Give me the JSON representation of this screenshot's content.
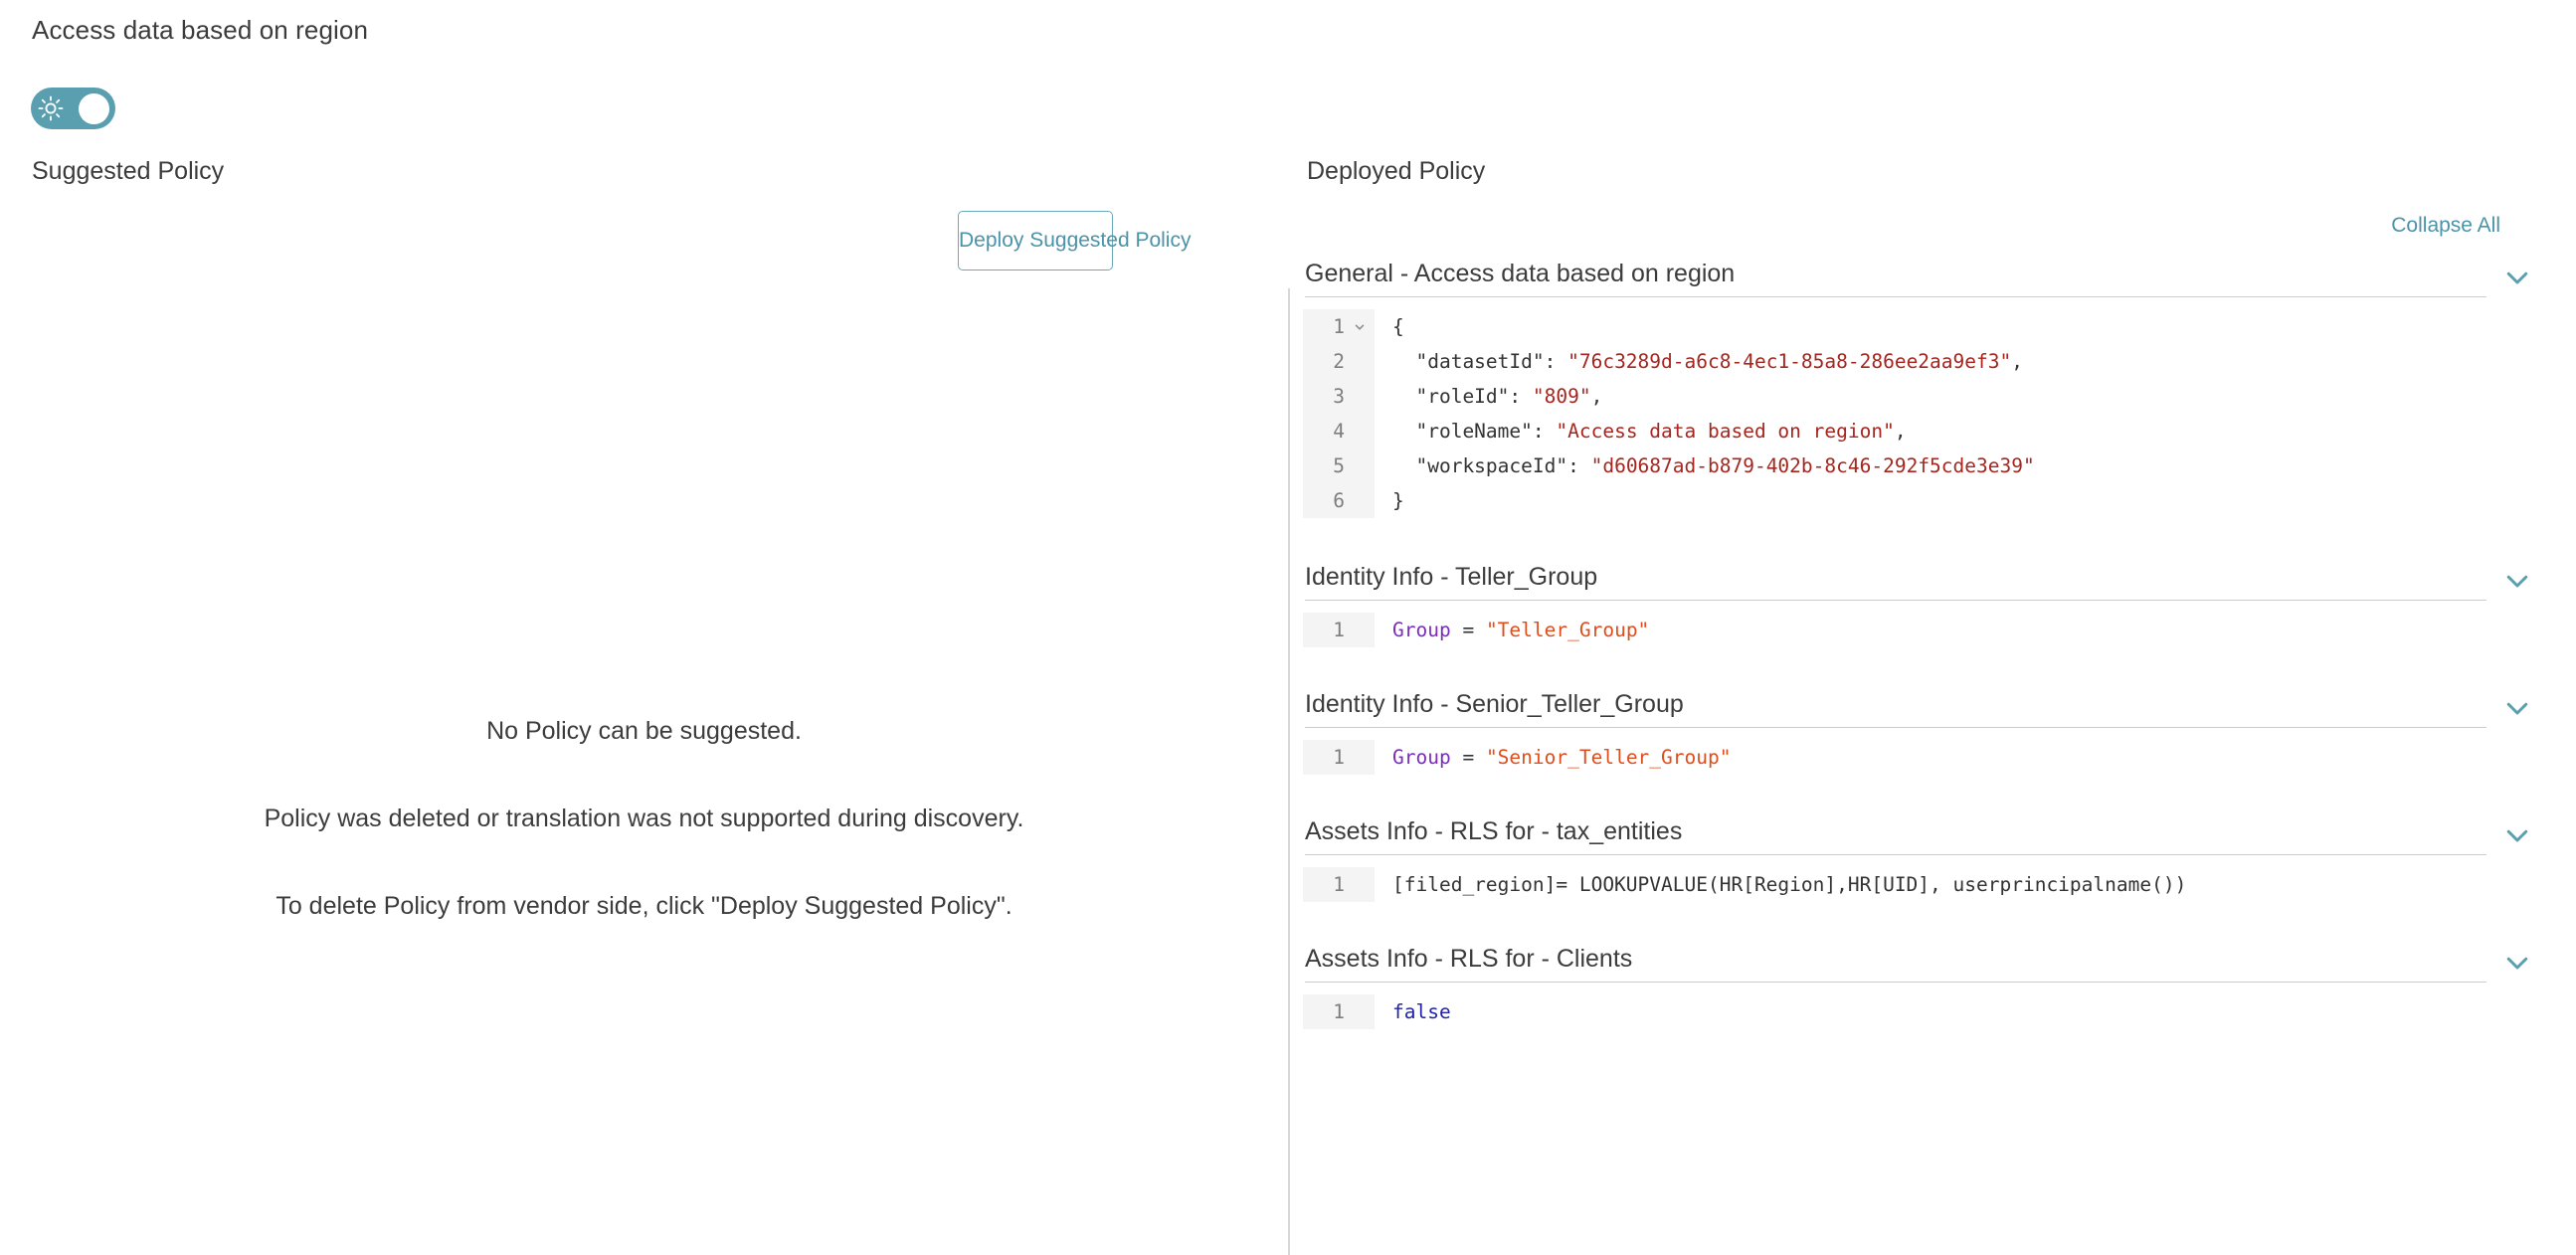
{
  "policy": {
    "name": "Access data based on region"
  },
  "toggle": {
    "icon": "sun-icon",
    "state": "on",
    "color": "#5a9fb0"
  },
  "columns": {
    "left_heading": "Suggested Policy",
    "right_heading": "Deployed Policy"
  },
  "left_pane": {
    "deploy_button": "Deploy Suggested Policy",
    "empty_state": [
      "No Policy can be suggested.",
      "Policy was deleted or translation was not supported during discovery.",
      "To delete Policy from vendor side, click \"Deploy Suggested Policy\"."
    ]
  },
  "right_pane": {
    "collapse_all": "Collapse All",
    "chevron_icon": "chevron-down-icon",
    "accent_color": "#4a93a8",
    "sections": [
      {
        "title": "General - Access data based on region",
        "language": "json",
        "lines": [
          {
            "n": "1",
            "fold": true,
            "tokens": [
              {
                "t": "{",
                "c": "pl"
              }
            ]
          },
          {
            "n": "2",
            "fold": false,
            "tokens": [
              {
                "t": "  \"datasetId\": ",
                "c": "key"
              },
              {
                "t": "\"76c3289d-a6c8-4ec1-85a8-286ee2aa9ef3\"",
                "c": "str"
              },
              {
                "t": ",",
                "c": "pl"
              }
            ]
          },
          {
            "n": "3",
            "fold": false,
            "tokens": [
              {
                "t": "  \"roleId\": ",
                "c": "key"
              },
              {
                "t": "\"809\"",
                "c": "str"
              },
              {
                "t": ",",
                "c": "pl"
              }
            ]
          },
          {
            "n": "4",
            "fold": false,
            "tokens": [
              {
                "t": "  \"roleName\": ",
                "c": "key"
              },
              {
                "t": "\"Access data based on region\"",
                "c": "str"
              },
              {
                "t": ",",
                "c": "pl"
              }
            ]
          },
          {
            "n": "5",
            "fold": false,
            "tokens": [
              {
                "t": "  \"workspaceId\": ",
                "c": "key"
              },
              {
                "t": "\"d60687ad-b879-402b-8c46-292f5cde3e39\"",
                "c": "str"
              }
            ]
          },
          {
            "n": "6",
            "fold": false,
            "tokens": [
              {
                "t": "}",
                "c": "pl"
              }
            ]
          }
        ]
      },
      {
        "title": "Identity Info - Teller_Group",
        "language": "dax",
        "lines": [
          {
            "n": "1",
            "fold": false,
            "tokens": [
              {
                "t": "Group",
                "c": "var"
              },
              {
                "t": " = ",
                "c": "pl"
              },
              {
                "t": "\"Teller_Group\"",
                "c": "sq"
              }
            ]
          }
        ]
      },
      {
        "title": "Identity Info - Senior_Teller_Group",
        "language": "dax",
        "lines": [
          {
            "n": "1",
            "fold": false,
            "tokens": [
              {
                "t": "Group",
                "c": "var"
              },
              {
                "t": " = ",
                "c": "pl"
              },
              {
                "t": "\"Senior_Teller_Group\"",
                "c": "sq"
              }
            ]
          }
        ]
      },
      {
        "title": "Assets Info - RLS for - tax_entities",
        "language": "dax",
        "lines": [
          {
            "n": "1",
            "fold": false,
            "tokens": [
              {
                "t": "[filed_region]= LOOKUPVALUE(HR[Region],HR[UID], userprincipalname())",
                "c": "pl"
              }
            ]
          }
        ]
      },
      {
        "title": "Assets Info - RLS for - Clients",
        "language": "dax",
        "lines": [
          {
            "n": "1",
            "fold": false,
            "tokens": [
              {
                "t": "false",
                "c": "kw"
              }
            ]
          }
        ]
      }
    ]
  }
}
